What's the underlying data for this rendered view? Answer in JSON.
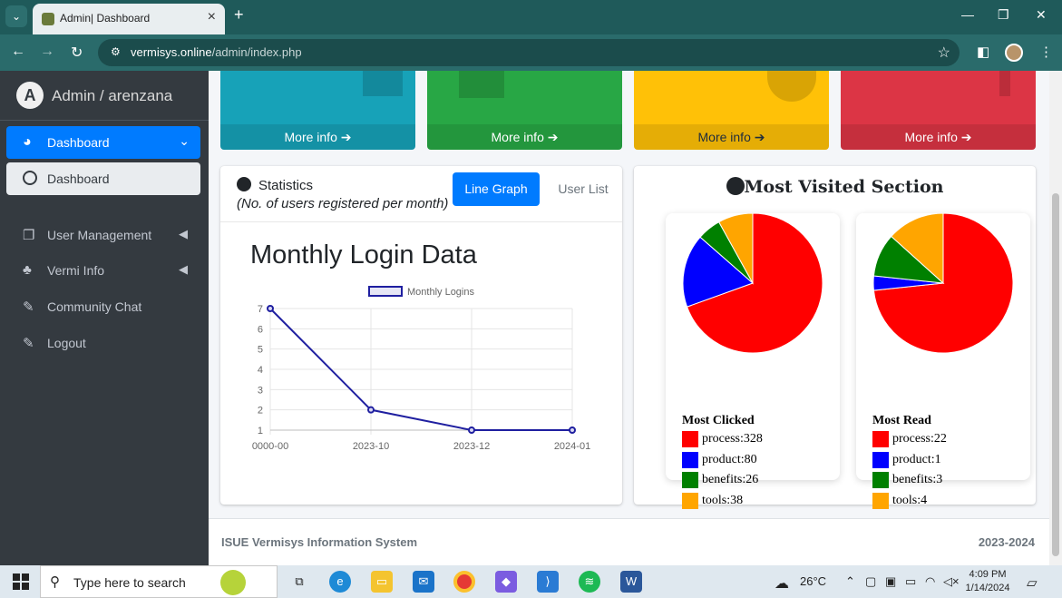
{
  "browser": {
    "tab_title": "Admin| Dashboard",
    "url_host": "vermisys.online",
    "url_path": "/admin/index.php"
  },
  "sidebar": {
    "brand": "Admin / arenzana",
    "items": [
      {
        "label": "Dashboard"
      },
      {
        "label": "Dashboard"
      },
      {
        "label": "User Management"
      },
      {
        "label": "Vermi Info"
      },
      {
        "label": "Community Chat"
      },
      {
        "label": "Logout"
      }
    ]
  },
  "small_boxes": [
    {
      "more": "More info",
      "color": "#17a2b8"
    },
    {
      "more": "More info",
      "color": "#28a745"
    },
    {
      "more": "More info",
      "color": "#ffc107"
    },
    {
      "more": "More info",
      "color": "#dc3545"
    }
  ],
  "statistics": {
    "title": "Statistics",
    "subtitle": "(No. of users registered per month)",
    "btn_line": "Line Graph",
    "btn_list": "User List",
    "chart_title": "Monthly Login Data"
  },
  "chart_data": {
    "type": "line",
    "title": "Monthly Login Data",
    "categories": [
      "0000-00",
      "2023-10",
      "2023-12",
      "2024-01"
    ],
    "series": [
      {
        "name": "Monthly Logins",
        "values": [
          7,
          2,
          1,
          1
        ]
      }
    ],
    "yticks": [
      "1",
      "2",
      "3",
      "4",
      "5",
      "6",
      "7"
    ],
    "ylim": [
      1,
      7
    ],
    "grid": true,
    "legend": "top",
    "color": "#1f1fa0"
  },
  "most_visited": {
    "title": "Most Visited Section",
    "pies": [
      {
        "title": "Most Clicked",
        "slices": [
          {
            "label": "process:328",
            "value": 328,
            "color": "#ff0000"
          },
          {
            "label": "product:80",
            "value": 80,
            "color": "#0000ff"
          },
          {
            "label": "benefits:26",
            "value": 26,
            "color": "#008000"
          },
          {
            "label": "tools:38",
            "value": 38,
            "color": "#ffa500"
          }
        ]
      },
      {
        "title": "Most Read",
        "slices": [
          {
            "label": "process:22",
            "value": 22,
            "color": "#ff0000"
          },
          {
            "label": "product:1",
            "value": 1,
            "color": "#0000ff"
          },
          {
            "label": "benefits:3",
            "value": 3,
            "color": "#008000"
          },
          {
            "label": "tools:4",
            "value": 4,
            "color": "#ffa500"
          }
        ]
      }
    ]
  },
  "footer": {
    "left": "ISUE Vermisys Information System",
    "right": "2023-2024"
  },
  "taskbar": {
    "search_placeholder": "Type here to search",
    "temperature": "26°C",
    "time": "4:09 PM",
    "date": "1/14/2024"
  }
}
